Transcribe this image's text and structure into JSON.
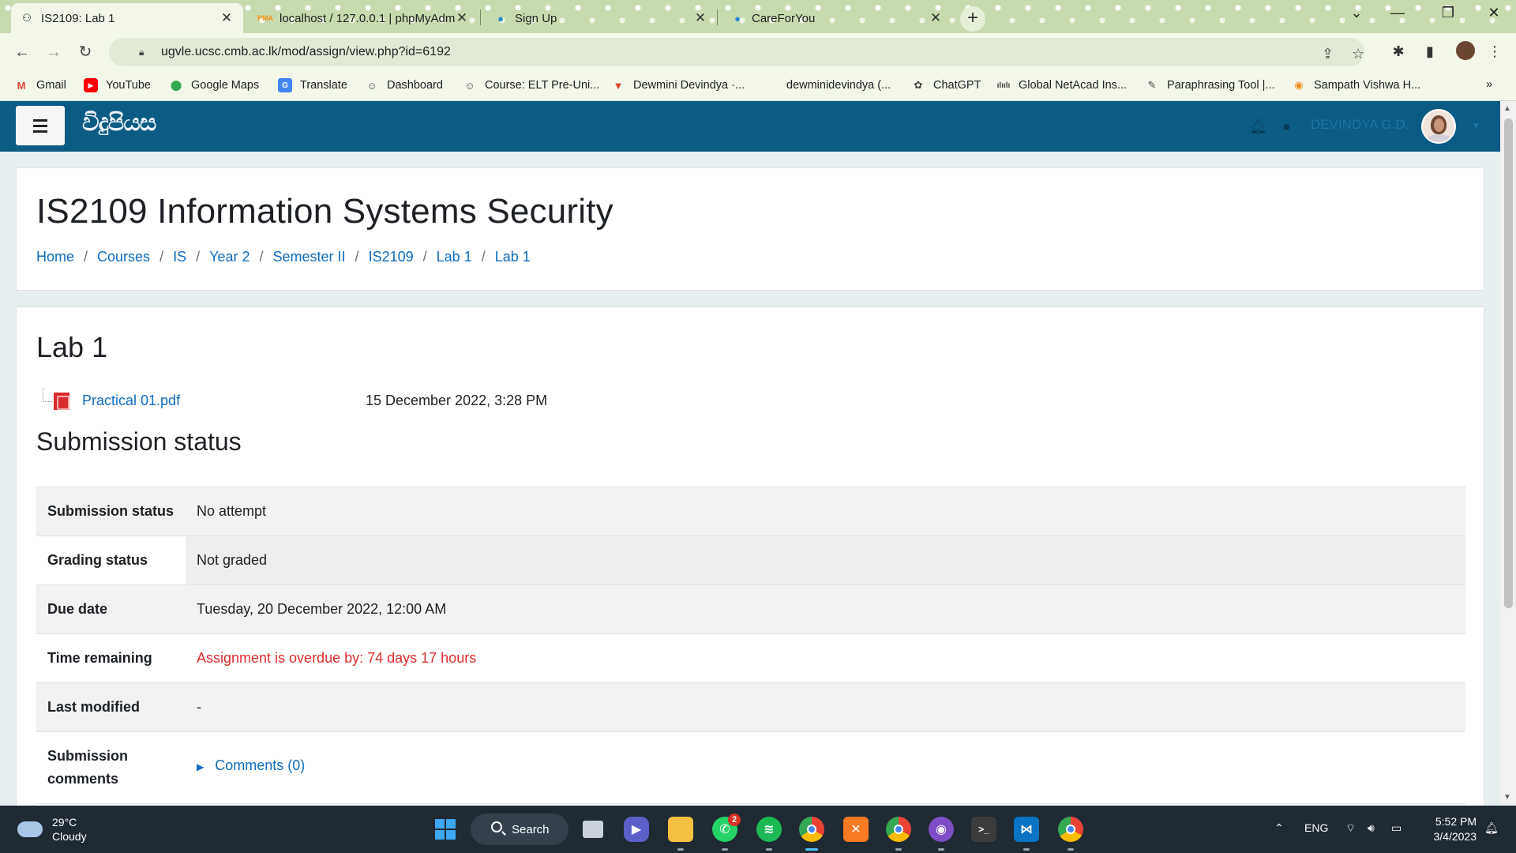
{
  "browser": {
    "tabs": [
      {
        "title": "IS2109: Lab 1",
        "active": true
      },
      {
        "title": "localhost / 127.0.0.1 | phpMyAdm",
        "active": false
      },
      {
        "title": "Sign Up",
        "active": false
      },
      {
        "title": "CareForYou",
        "active": false
      }
    ],
    "url": "ugvle.ucsc.cmb.ac.lk/mod/assign/view.php?id=6192",
    "bookmarks": [
      {
        "label": "Gmail",
        "icon": "gmail-icon",
        "color": "#ea4335"
      },
      {
        "label": "YouTube",
        "icon": "youtube-icon",
        "color": "#ff0000"
      },
      {
        "label": "Google Maps",
        "icon": "maps-icon",
        "color": "#34a853"
      },
      {
        "label": "Translate",
        "icon": "translate-icon",
        "color": "#4285f4"
      },
      {
        "label": "Dashboard",
        "icon": "moodle-icon",
        "color": "#555555"
      },
      {
        "label": "Course: ELT Pre-Uni...",
        "icon": "moodle-icon",
        "color": "#555555"
      },
      {
        "label": "Dewmini Devindya ·...",
        "icon": "gitlab-icon",
        "color": "#e24329"
      },
      {
        "label": "dewminidevindya (...",
        "icon": "github-icon",
        "color": "#222222"
      },
      {
        "label": "ChatGPT",
        "icon": "chatgpt-icon",
        "color": "#444444"
      },
      {
        "label": "Global NetAcad Ins...",
        "icon": "cisco-icon",
        "color": "#444444"
      },
      {
        "label": "Paraphrasing Tool |...",
        "icon": "feather-icon",
        "color": "#444444"
      },
      {
        "label": "Sampath Vishwa H...",
        "icon": "sampath-icon",
        "color": "#f28c1c"
      }
    ],
    "more_bookmarks": "»"
  },
  "moodle_nav": {
    "logo_text": "විදුපියස",
    "username": "DEVINDYA G.D."
  },
  "course": {
    "title": "IS2109 Information Systems Security",
    "breadcrumb": [
      "Home",
      "Courses",
      "IS",
      "Year 2",
      "Semester II",
      "IS2109",
      "Lab 1",
      "Lab 1"
    ]
  },
  "assignment": {
    "title": "Lab 1",
    "file_name": "Practical 01.pdf",
    "file_date": "15 December 2022, 3:28 PM",
    "section_heading": "Submission status",
    "rows": [
      {
        "label": "Submission status",
        "value": "No attempt"
      },
      {
        "label": "Grading status",
        "value": "Not graded"
      },
      {
        "label": "Due date",
        "value": "Tuesday, 20 December 2022, 12:00 AM"
      },
      {
        "label": "Time remaining",
        "value": "Assignment is overdue by: 74 days 17 hours"
      },
      {
        "label": "Last modified",
        "value": "-"
      },
      {
        "label": "Submission comments",
        "value": "Comments (0)"
      }
    ]
  },
  "taskbar": {
    "weather_temp": "29°C",
    "weather_desc": "Cloudy",
    "search_label": "Search",
    "whatsapp_badge": "2",
    "lang": "ENG",
    "time": "5:52 PM",
    "date": "3/4/2023"
  },
  "colors": {
    "navbar": "#0c5b84",
    "link": "#0f6cbf",
    "overdue": "#e12c2c"
  }
}
